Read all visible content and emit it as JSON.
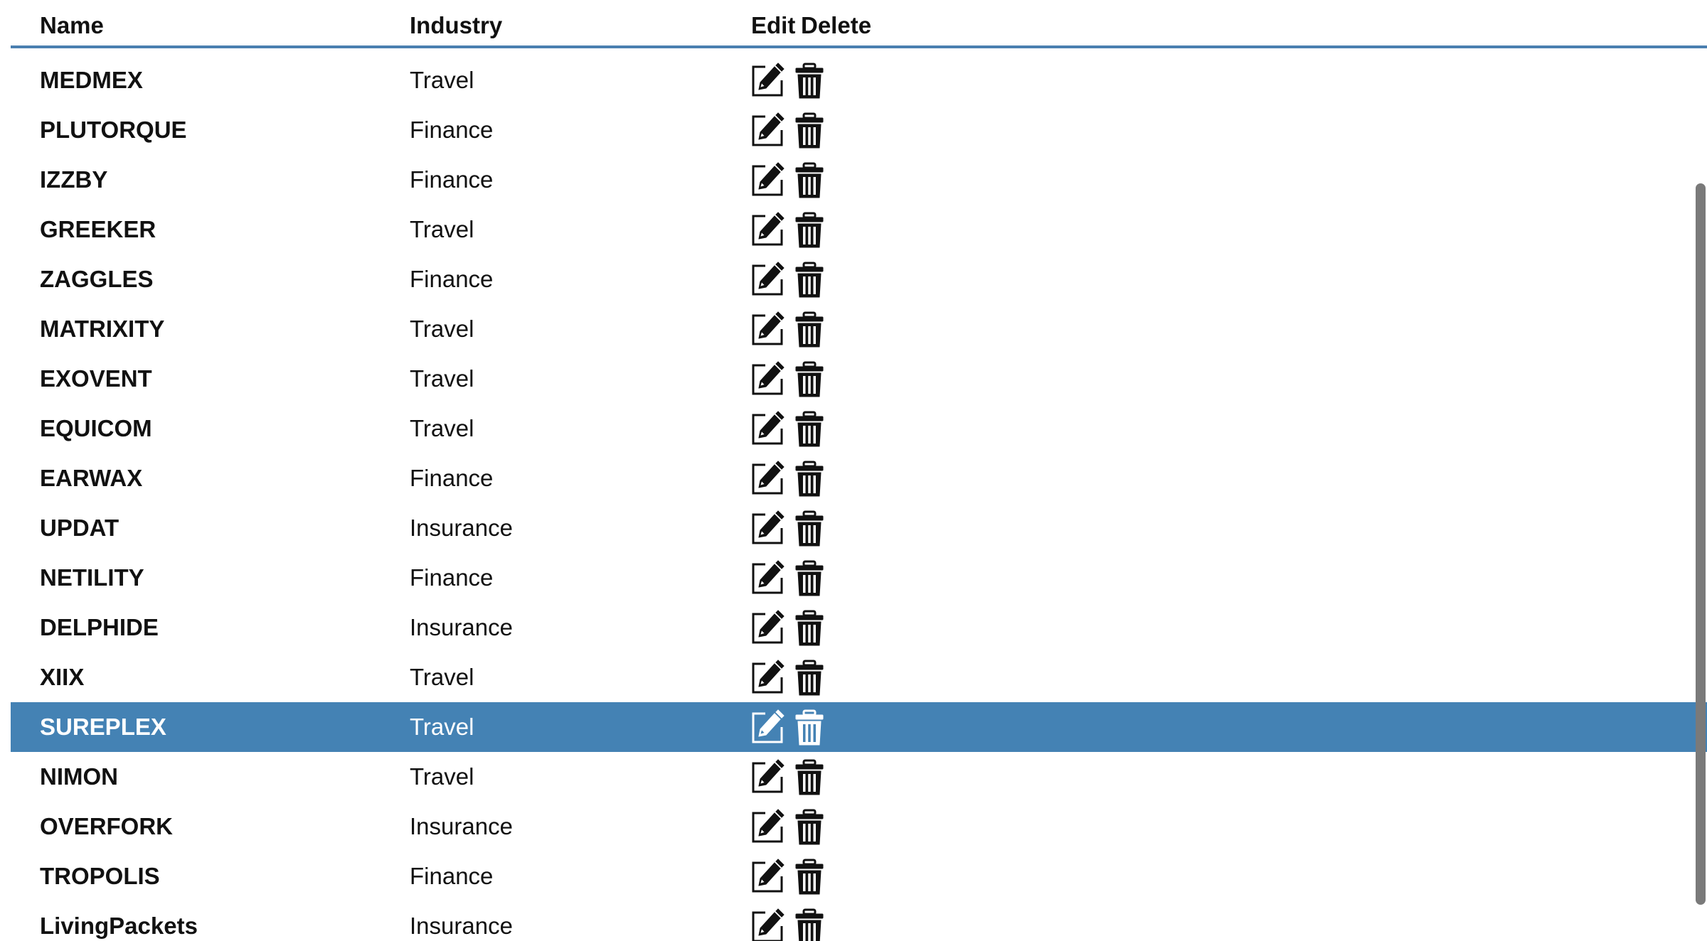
{
  "table": {
    "columns": {
      "name": "Name",
      "industry": "Industry",
      "edit": "Edit",
      "delete": "Delete"
    },
    "rows": [
      {
        "name": "MEDMEX",
        "industry": "Travel",
        "selected": false
      },
      {
        "name": "PLUTORQUE",
        "industry": "Finance",
        "selected": false
      },
      {
        "name": "IZZBY",
        "industry": "Finance",
        "selected": false
      },
      {
        "name": "GREEKER",
        "industry": "Travel",
        "selected": false
      },
      {
        "name": "ZAGGLES",
        "industry": "Finance",
        "selected": false
      },
      {
        "name": "MATRIXITY",
        "industry": "Travel",
        "selected": false
      },
      {
        "name": "EXOVENT",
        "industry": "Travel",
        "selected": false
      },
      {
        "name": "EQUICOM",
        "industry": "Travel",
        "selected": false
      },
      {
        "name": "EARWAX",
        "industry": "Finance",
        "selected": false
      },
      {
        "name": "UPDAT",
        "industry": "Insurance",
        "selected": false
      },
      {
        "name": "NETILITY",
        "industry": "Finance",
        "selected": false
      },
      {
        "name": "DELPHIDE",
        "industry": "Insurance",
        "selected": false
      },
      {
        "name": "XIIX",
        "industry": "Travel",
        "selected": false
      },
      {
        "name": "SUREPLEX",
        "industry": "Travel",
        "selected": true
      },
      {
        "name": "NIMON",
        "industry": "Travel",
        "selected": false
      },
      {
        "name": "OVERFORK",
        "industry": "Insurance",
        "selected": false
      },
      {
        "name": "TROPOLIS",
        "industry": "Finance",
        "selected": false
      },
      {
        "name": "LivingPackets",
        "industry": "Insurance",
        "selected": false
      }
    ]
  },
  "icons": {
    "edit": "edit-pencil-square-icon",
    "delete": "trash-icon"
  },
  "colors": {
    "header_border": "#4a7fb0",
    "selected_row": "#4482b4",
    "selected_text": "#ffffff",
    "scrollbar": "#7a7a7a"
  }
}
